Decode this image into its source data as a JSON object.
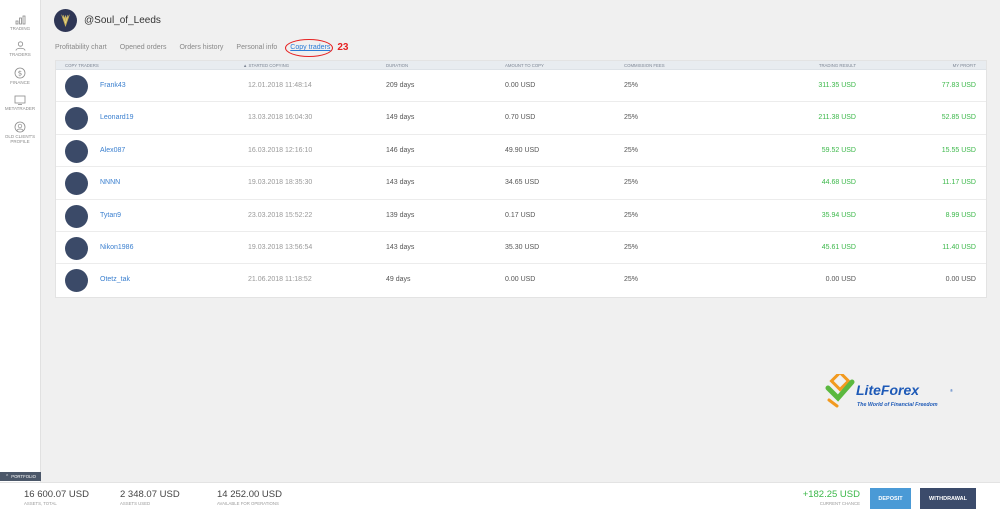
{
  "sidebar": {
    "items": [
      {
        "label": "TRADING",
        "icon": "chart-icon"
      },
      {
        "label": "TRADERS",
        "icon": "traders-icon"
      },
      {
        "label": "FINANCE",
        "icon": "finance-icon"
      },
      {
        "label": "METATRADER",
        "icon": "monitor-icon"
      },
      {
        "label": "OLD CLIENT'S PROFILE",
        "icon": "profile-icon"
      }
    ]
  },
  "header": {
    "username": "@Soul_of_Leeds"
  },
  "tabs": [
    {
      "label": "Profitability chart"
    },
    {
      "label": "Opened orders"
    },
    {
      "label": "Orders history"
    },
    {
      "label": "Personal info"
    },
    {
      "label": "Copy traders"
    }
  ],
  "annotation": "23",
  "table": {
    "headers": {
      "trader": "COPY TRADERS",
      "started": "▲ STARTED COPYING",
      "duration": "DURATION",
      "amount": "AMOUNT TO COPY",
      "commission": "COMMISSION FEES",
      "result": "TRADING RESULT",
      "profit": "MY PROFIT"
    },
    "rows": [
      {
        "name": "Frank43",
        "started": "12.01.2018 11:48:14",
        "duration": "209 days",
        "amount": "0.00 USD",
        "commission": "25%",
        "result": "311.35 USD",
        "profit": "77.83 USD"
      },
      {
        "name": "Leonard19",
        "started": "13.03.2018 16:04:30",
        "duration": "149 days",
        "amount": "0.70 USD",
        "commission": "25%",
        "result": "211.38 USD",
        "profit": "52.85 USD"
      },
      {
        "name": "Alex087",
        "started": "16.03.2018 12:16:10",
        "duration": "146 days",
        "amount": "49.90 USD",
        "commission": "25%",
        "result": "59.52 USD",
        "profit": "15.55 USD"
      },
      {
        "name": "NNNN",
        "started": "19.03.2018 18:35:30",
        "duration": "143 days",
        "amount": "34.65 USD",
        "commission": "25%",
        "result": "44.68 USD",
        "profit": "11.17 USD"
      },
      {
        "name": "Tytan9",
        "started": "23.03.2018 15:52:22",
        "duration": "139 days",
        "amount": "0.17 USD",
        "commission": "25%",
        "result": "35.94 USD",
        "profit": "8.99 USD"
      },
      {
        "name": "Nikon1986",
        "started": "19.03.2018 13:56:54",
        "duration": "143 days",
        "amount": "35.30 USD",
        "commission": "25%",
        "result": "45.61 USD",
        "profit": "11.40 USD"
      },
      {
        "name": "Otetz_tak",
        "started": "21.06.2018 11:18:52",
        "duration": "49 days",
        "amount": "0.00 USD",
        "commission": "25%",
        "result": "0.00 USD",
        "profit": "0.00 USD"
      }
    ]
  },
  "logo": {
    "name": "LiteForex",
    "tagline": "The World of Financial Freedom",
    "reg": "®"
  },
  "portfolio_label": "PORTFOLIO",
  "footer": {
    "assets_total": {
      "value": "16 600.07 USD",
      "label": "ASSETS, TOTAL"
    },
    "assets_used": {
      "value": "2 348.07 USD",
      "label": "ASSETS USED"
    },
    "available": {
      "value": "14 252.00 USD",
      "label": "AVAILABLE FOR OPERATIONS"
    },
    "change": {
      "value": "+182.25 USD",
      "label": "CURRENT CHANCE"
    },
    "deposit_label": "DEPOSIT",
    "withdraw_label": "WITHDRAWAL"
  },
  "colors": {
    "accent": "#2a7bd6",
    "positive": "#3cb84a",
    "annotation": "#e62222",
    "avatar": "#3b4a68",
    "deposit": "#4a9ad6",
    "withdraw": "#3b4b6b"
  }
}
